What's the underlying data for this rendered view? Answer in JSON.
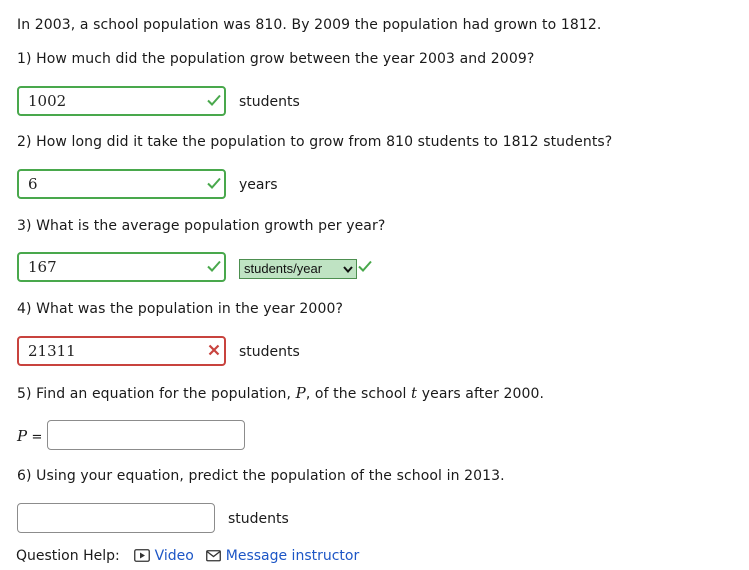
{
  "intro": "In 2003, a school population was 810. By 2009 the population had grown to 1812.",
  "questions": [
    {
      "text": "1) How much did the population grow between the year 2003 and 2009?",
      "value": "1002",
      "unit": "students",
      "status": "correct"
    },
    {
      "text": "2) How long did it take the population to grow from 810 students to 1812 students?",
      "value": "6",
      "unit": "years",
      "status": "correct"
    },
    {
      "text": "3) What is the average population growth per year?",
      "value": "167",
      "unit_select": "students/year",
      "status": "correct"
    },
    {
      "text": "4) What was the population in the year 2000?",
      "value": "21311",
      "unit": "students",
      "status": "incorrect"
    },
    {
      "text_before": "5) Find an equation for the population, ",
      "var_p": "P",
      "text_mid": ", of the school ",
      "var_t": "t",
      "text_after": " years after 2000.",
      "lhs": "P",
      "eq": "=",
      "value": ""
    },
    {
      "text": "6) Using your equation, predict the population of the school in 2013.",
      "value": "",
      "unit": "students"
    }
  ],
  "help": {
    "label": "Question Help:",
    "video": "Video",
    "message": "Message instructor"
  },
  "colors": {
    "correct": "#49a84c",
    "incorrect": "#c8433e",
    "link": "#1d56c6"
  }
}
